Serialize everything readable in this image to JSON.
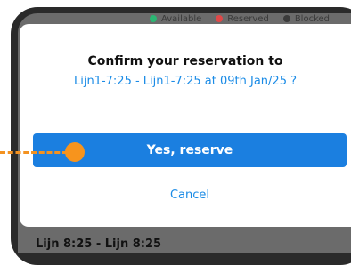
{
  "legend": {
    "available": "Available",
    "reserved": "Reserved",
    "blocked": "Blocked"
  },
  "dialog": {
    "title": "Confirm your reservation to",
    "subtitle": "Lijn1-7:25 - Lijn1-7:25 at 09th Jan/25 ?",
    "confirm_label": "Yes, reserve",
    "cancel_label": "Cancel"
  },
  "background": {
    "bottom_text": "Lijn 8:25 - Lijn 8:25"
  },
  "colors": {
    "primary": "#1b7fe0",
    "link": "#1a8be6",
    "pointer": "#f7941d"
  }
}
